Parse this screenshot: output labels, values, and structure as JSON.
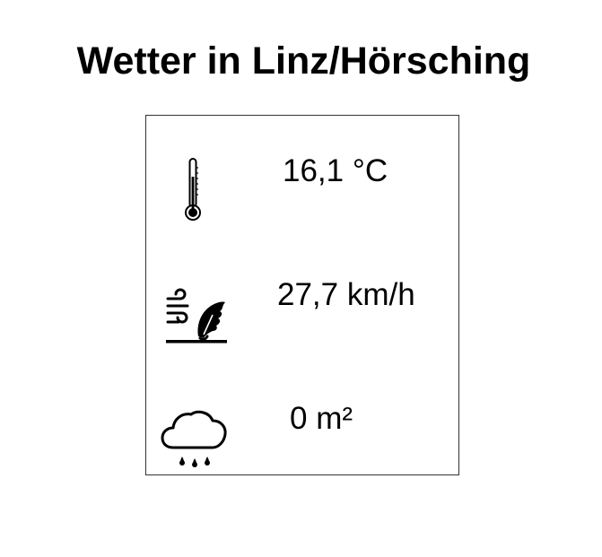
{
  "page": {
    "title": "Wetter in Linz/Hörsching"
  },
  "weather": {
    "temperature": {
      "icon": "thermometer-icon",
      "value": "16,1 °C"
    },
    "wind": {
      "icon": "wind-icon",
      "value": "27,7 km/h"
    },
    "precipitation": {
      "icon": "rain-cloud-icon",
      "value": "0 m²"
    }
  },
  "colors": {
    "text": "#000000",
    "border": "#333333",
    "background": "#ffffff"
  }
}
